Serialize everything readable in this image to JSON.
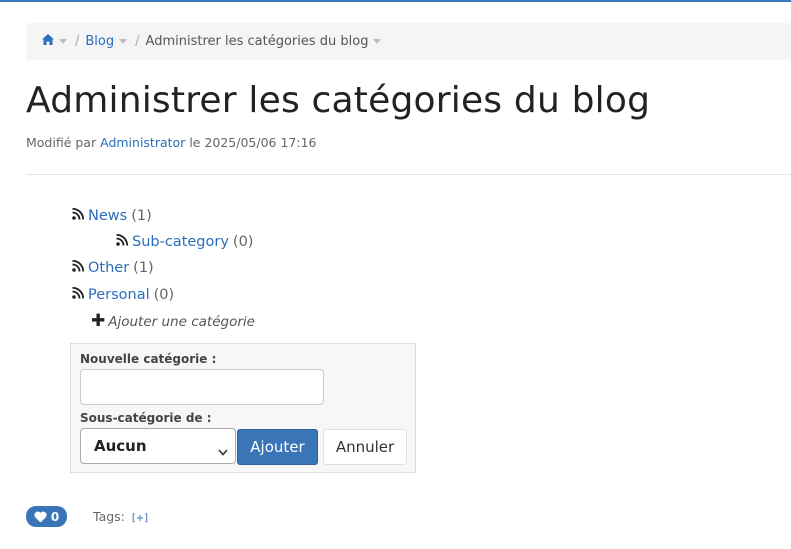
{
  "breadcrumb": {
    "home_icon": "home-icon",
    "separator": "/",
    "blog": "Blog",
    "current": "Administrer les catégories du blog"
  },
  "page": {
    "title": "Administrer les catégories du blog",
    "modified_prefix": "Modifié par",
    "author": "Administrator",
    "modified_suffix": "le 2025/05/06 17:16"
  },
  "categories": [
    {
      "name": "News",
      "count": "(1)",
      "icon": "rss-icon"
    },
    {
      "name": "Sub-category",
      "count": "(0)",
      "icon": "rss-icon"
    },
    {
      "name": "Other",
      "count": "(1)",
      "icon": "rss-icon"
    },
    {
      "name": "Personal",
      "count": "(0)",
      "icon": "rss-icon"
    }
  ],
  "add_category": {
    "icon": "plus-icon",
    "label": "Ajouter une catégorie"
  },
  "form": {
    "new_label": "Nouvelle catégorie :",
    "new_value": "",
    "parent_label": "Sous-catégorie de :",
    "parent_selected": "Aucun",
    "submit": "Ajouter",
    "cancel": "Annuler"
  },
  "footer": {
    "likes": "0",
    "tags_label": "Tags:",
    "tags_add": "[+]"
  },
  "colors": {
    "link": "#2a6ebb",
    "primary": "#3a75b8"
  }
}
